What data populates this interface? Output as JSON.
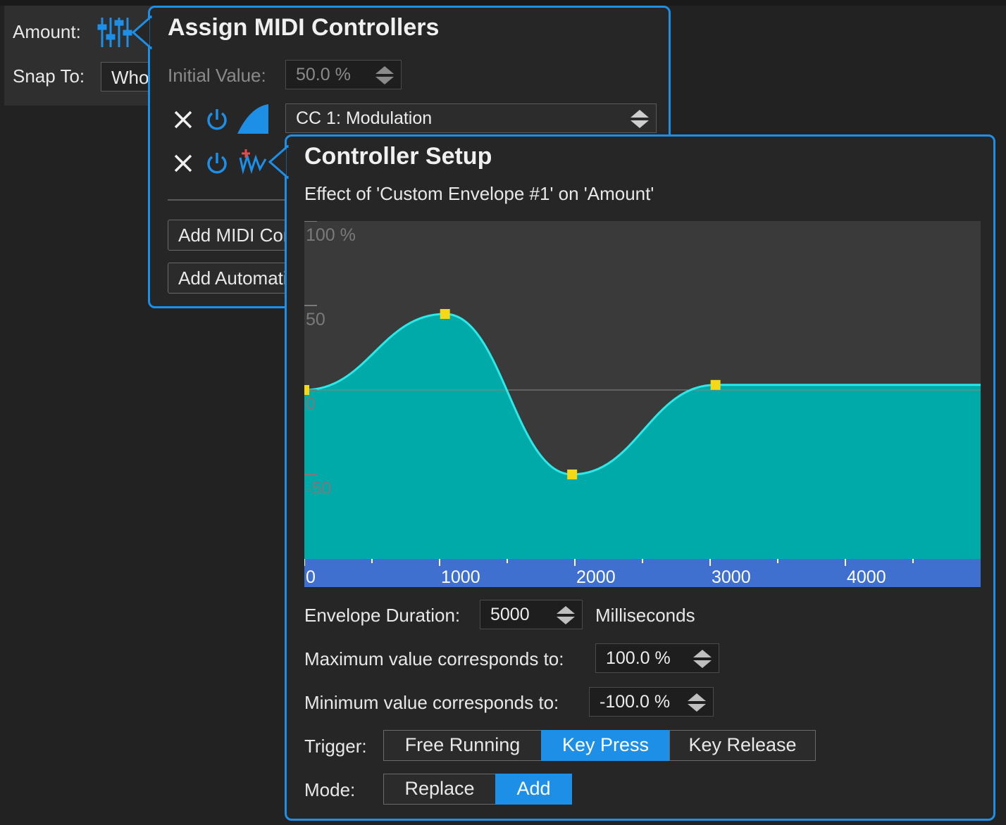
{
  "host": {
    "amount_label": "Amount:",
    "snap_label": "Snap To:",
    "snap_value": "Who",
    "amount_icon": "sliders-icon"
  },
  "assign_popup": {
    "title": "Assign MIDI Controllers",
    "initial_value_label": "Initial Value:",
    "initial_value": "50.0 %",
    "controller_1": "CC 1: Modulation",
    "add_midi_button": "Add MIDI Controller",
    "add_automation_button": "Add Automation"
  },
  "controller_setup": {
    "title": "Controller Setup",
    "subtitle": "Effect of 'Custom Envelope #1' on 'Amount'",
    "envelope_duration_label": "Envelope Duration:",
    "envelope_duration_value": "5000",
    "envelope_duration_unit": "Milliseconds",
    "max_label": "Maximum value corresponds to:",
    "max_value": "100.0 %",
    "min_label": "Minimum value corresponds to:",
    "min_value": "-100.0 %",
    "trigger_label": "Trigger:",
    "trigger_options": [
      "Free Running",
      "Key Press",
      "Key Release"
    ],
    "trigger_selected": "Key Press",
    "mode_label": "Mode:",
    "mode_options": [
      "Replace",
      "Add"
    ],
    "mode_selected": "Add",
    "accent_color": "#1e8fe6"
  },
  "chart_data": {
    "type": "area",
    "title": "",
    "xlabel": "",
    "ylabel": "",
    "xlim": [
      0,
      5000
    ],
    "ylim": [
      -100,
      100
    ],
    "y_tick_labels": [
      "100 %",
      "50",
      "0",
      "-50"
    ],
    "y_ticks": [
      100,
      50,
      0,
      -50
    ],
    "x_ticks": [
      0,
      1000,
      2000,
      3000,
      4000
    ],
    "x_tick_labels": [
      "0",
      "1000",
      "2000",
      "3000",
      "4000"
    ],
    "control_points": [
      {
        "x": 0,
        "y": 0
      },
      {
        "x": 1040,
        "y": 45
      },
      {
        "x": 1980,
        "y": -50
      },
      {
        "x": 3040,
        "y": 3
      },
      {
        "x": 5000,
        "y": 3
      }
    ],
    "fill_color": "#00aaa8",
    "line_color": "#2de8e8",
    "point_color": "#f5d916"
  }
}
